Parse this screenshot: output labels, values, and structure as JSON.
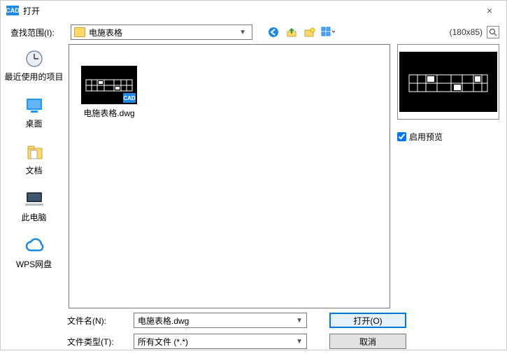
{
  "title": "打开",
  "app_icon_text": "CAD",
  "close_glyph": "×",
  "lookup_label": "查找范围(I):",
  "lookup_value": "电施表格",
  "toolbar_icons": [
    "back",
    "up",
    "newfolder",
    "views"
  ],
  "preview_dim": "(180x85)",
  "sidebar": [
    {
      "name": "recent",
      "label": "最近使用的项目"
    },
    {
      "name": "desktop",
      "label": "桌面"
    },
    {
      "name": "documents",
      "label": "文档"
    },
    {
      "name": "thispc",
      "label": "此电脑"
    },
    {
      "name": "wps",
      "label": "WPS网盘"
    }
  ],
  "files": [
    {
      "label": "电施表格.dwg",
      "badge": "CAD"
    }
  ],
  "enable_preview_label": "启用预览",
  "filename_label": "文件名(N):",
  "filename_value": "电施表格.dwg",
  "filetype_label": "文件类型(T):",
  "filetype_value": "所有文件 (*.*)",
  "open_button": "打开(O)",
  "cancel_button": "取消"
}
